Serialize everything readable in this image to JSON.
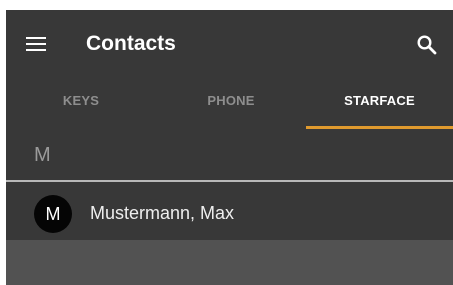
{
  "app_bar": {
    "title": "Contacts",
    "menu_icon": "hamburger-menu-icon",
    "search_icon": "search-icon"
  },
  "tabs": [
    {
      "label": "KEYS",
      "active": false
    },
    {
      "label": "PHONE",
      "active": false
    },
    {
      "label": "STARFACE",
      "active": true
    }
  ],
  "contacts": {
    "section_letter": "M",
    "items": [
      {
        "initial": "M",
        "name": "Mustermann, Max"
      }
    ]
  },
  "colors": {
    "background": "#383838",
    "tab_indicator": "#e09a2e",
    "avatar": "#050505",
    "empty_area": "#525252"
  }
}
